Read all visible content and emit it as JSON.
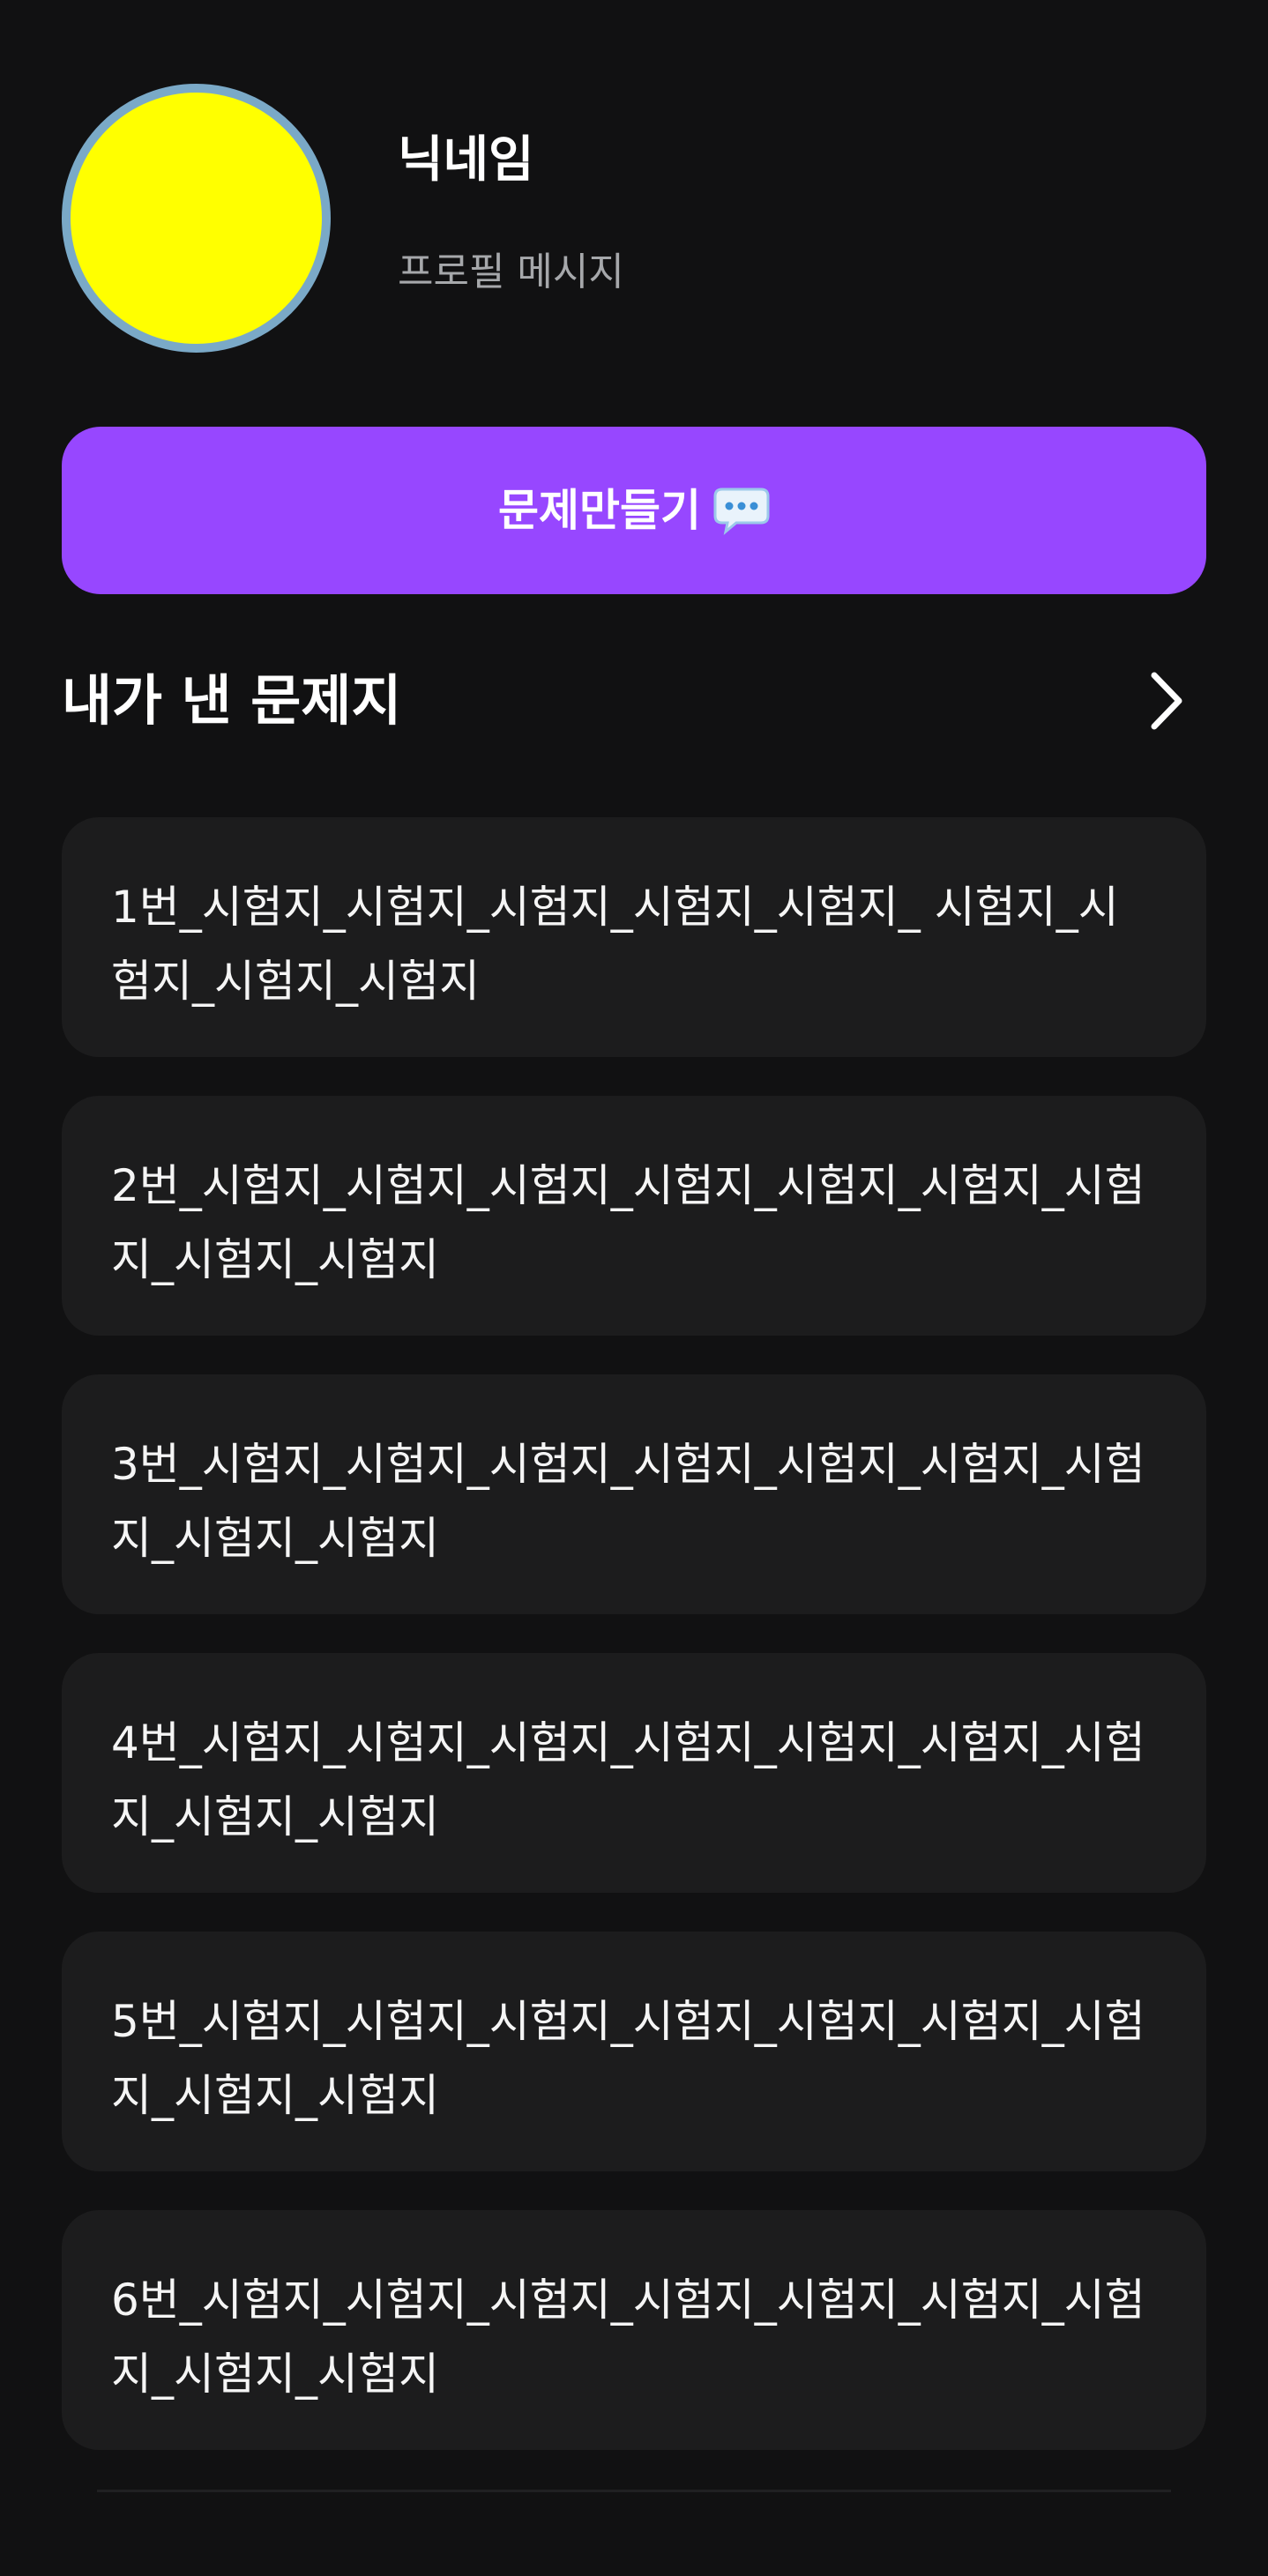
{
  "profile": {
    "avatar_color": "#ffff00",
    "avatar_border_color": "#7aa9c7",
    "nickname": "닉네임",
    "message": "프로필 메시지"
  },
  "create_button": {
    "label": "문제만들기",
    "icon": "speech-bubble-icon",
    "color": "#9747ff"
  },
  "section": {
    "title": "내가 낸 문제지",
    "more_icon": "chevron-right-icon"
  },
  "exams": [
    {
      "title": "1번_시험지_시험지_시험지_시험지_시험지_ 시험지_시험지_시험지_시험지"
    },
    {
      "title": "2번_시험지_시험지_시험지_시험지_시험지_시험지_시험지_시험지_시험지"
    },
    {
      "title": "3번_시험지_시험지_시험지_시험지_시험지_시험지_시험지_시험지_시험지"
    },
    {
      "title": "4번_시험지_시험지_시험지_시험지_시험지_시험지_시험지_시험지_시험지"
    },
    {
      "title": "5번_시험지_시험지_시험지_시험지_시험지_시험지_시험지_시험지_시험지"
    },
    {
      "title": "6번_시험지_시험지_시험지_시험지_시험지_시험지_시험지_시험지_시험지"
    }
  ]
}
